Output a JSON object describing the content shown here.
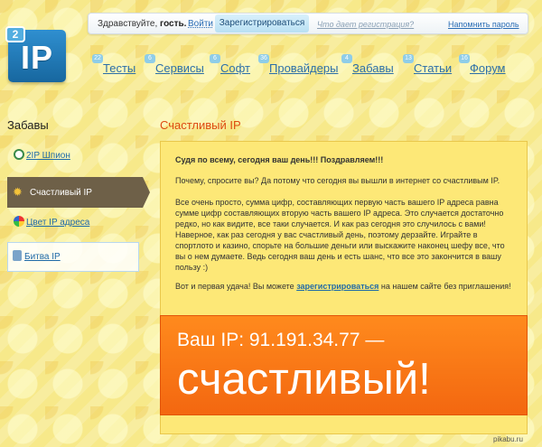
{
  "topbar": {
    "greeting_prefix": "Здравствуйте,",
    "greeting_user": "гость.",
    "login": "Войти",
    "register": "Зарегистрироваться",
    "why_register": "Что дает регистрация?",
    "remind_password": "Напомнить пароль"
  },
  "logo": {
    "number": "2",
    "text": "IP"
  },
  "nav": [
    {
      "badge": "22",
      "label": "Тесты"
    },
    {
      "badge": "6",
      "label": "Сервисы"
    },
    {
      "badge": "6",
      "label": "Софт"
    },
    {
      "badge": "36",
      "label": "Провайдеры"
    },
    {
      "badge": "4",
      "label": "Забавы"
    },
    {
      "badge": "13",
      "label": "Статьи"
    },
    {
      "badge": "16",
      "label": "Форум"
    }
  ],
  "sidebar": {
    "title": "Забавы",
    "items": [
      {
        "label": "2IP Шпион"
      },
      {
        "label": "Счастливый IP"
      },
      {
        "label": "Цвет IP адреса"
      },
      {
        "label": "Битва IP"
      }
    ]
  },
  "content": {
    "title": "Счастливый IP",
    "lead": "Судя по всему, сегодня ваш день!!! Поздравляем!!!",
    "p2": "Почему, спросите вы? Да потому что сегодня вы вышли в интернет со счастливым IP.",
    "p3": "Все очень просто, сумма цифр, составляющих первую часть вашего IP адреса равна сумме цифр составляющих вторую часть вашего IP адреса.  Это случается достаточно редко, но как видите, все таки случается. И как раз сегодня это случилось с вами! Наверное, как раз сегодня у вас счастливый день, поэтому дерзайте. Играйте в спортлото и казино, спорьте на большие деньги или выскажите наконец  шефу все, что вы о нем думаете. Ведь сегодня ваш день и есть шанс, что все это закончится в вашу пользу :)",
    "p4_before": "Вот и первая удача! Вы можете ",
    "p4_link": "зарегистрироваться",
    "p4_after": " на нашем сайте без приглашения!",
    "banner_line": "Ваш IP:  91.191.34.77 —",
    "banner_big": "счастливый!"
  },
  "watermark": "pikabu.ru",
  "colors": {
    "accent": "#dd4a10",
    "banner": "#f36710",
    "link": "#1f6aa7",
    "panel": "#fde877"
  }
}
